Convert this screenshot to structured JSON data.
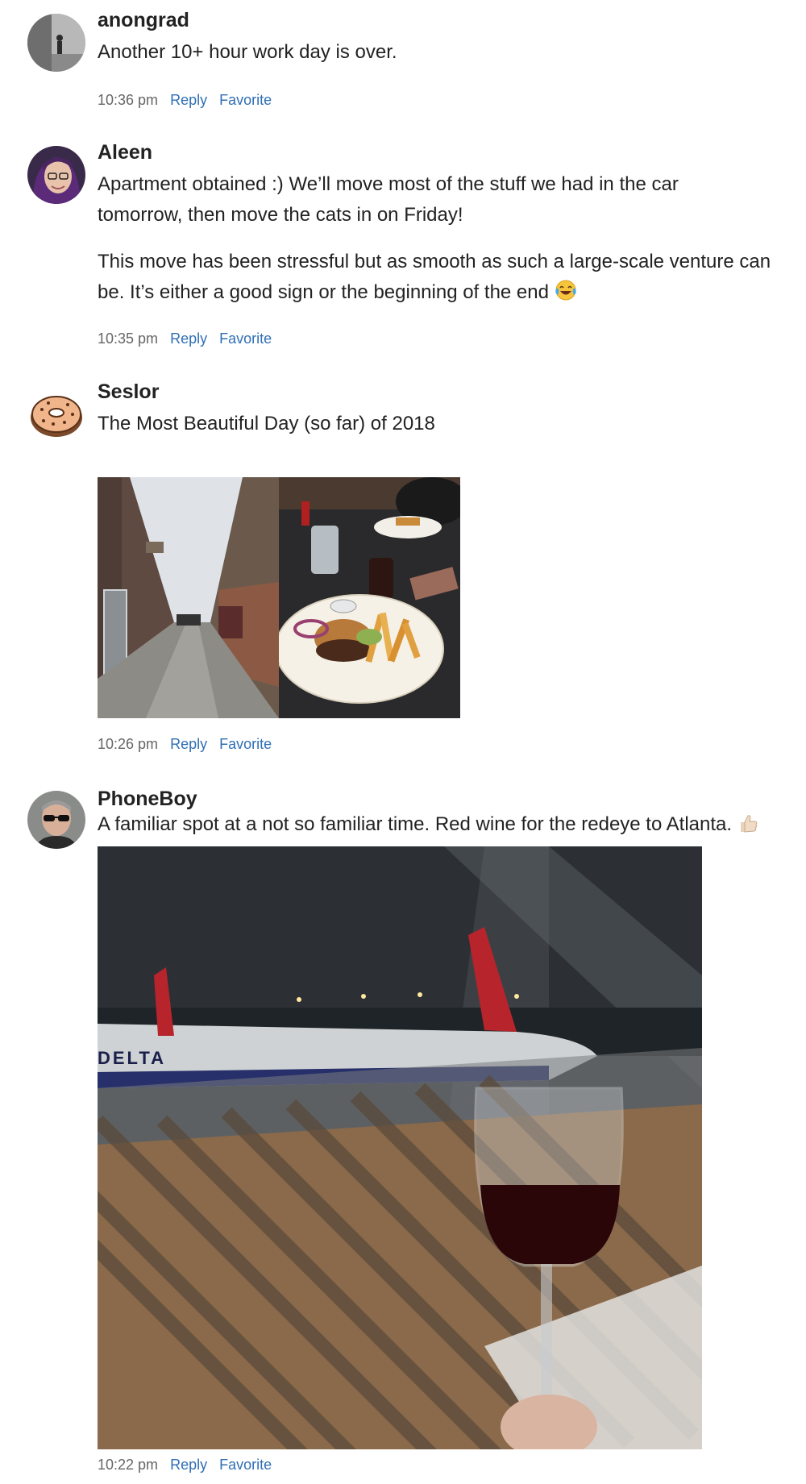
{
  "posts": [
    {
      "username": "anongrad",
      "paragraphs": [
        "Another 10+ hour work day is over."
      ],
      "time": "10:36 pm",
      "reply_label": "Reply",
      "favorite_label": "Favorite"
    },
    {
      "username": "Aleen",
      "paragraphs": [
        "Apartment obtained :) We’ll move most of the stuff we had in the car",
        "tomorrow, then move the cats in on Friday!",
        "This move has been stressful but as smooth as such a large-scale venture can",
        "be. It’s either a good sign or the beginning of the end"
      ],
      "emoji": "tears-of-joy-emoji",
      "time": "10:35 pm",
      "reply_label": "Reply",
      "favorite_label": "Favorite"
    },
    {
      "username": "Seslor",
      "paragraphs": [
        "The Most Beautiful Day (so far) of 2018"
      ],
      "photos": [
        "alley-photo",
        "burger-fries-photo"
      ],
      "time": "10:26 pm",
      "reply_label": "Reply",
      "favorite_label": "Favorite"
    },
    {
      "username": "PhoneBoy",
      "paragraphs": [
        "A familiar spot at a not so familiar time. Red wine for the redeye to Atlanta."
      ],
      "emoji": "thumbs-up-emoji",
      "photos": [
        "airport-wine-photo"
      ],
      "photo_text": "DELTA",
      "time": "10:22 pm",
      "reply_label": "Reply",
      "favorite_label": "Favorite"
    }
  ],
  "colors": {
    "link": "#2f6fb5",
    "meta": "#666666",
    "text": "#222222"
  }
}
